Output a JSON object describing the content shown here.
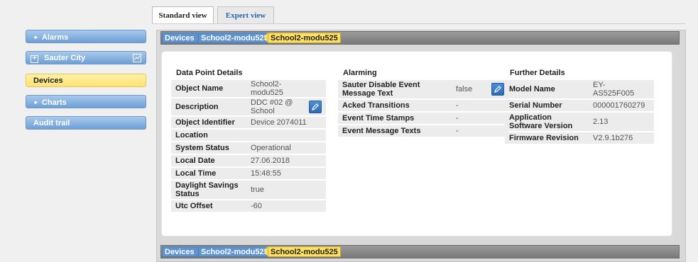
{
  "tabs": {
    "standard": "Standard view",
    "expert": "Expert view"
  },
  "sidebar": {
    "items": [
      {
        "label": "Alarms",
        "icon": "triangle-right-icon"
      },
      {
        "label": "Sauter City",
        "icon": "expand-plus-icon"
      },
      {
        "label": "Devices"
      },
      {
        "label": "Charts",
        "icon": "triangle-right-icon"
      },
      {
        "label": "Audit trail"
      }
    ]
  },
  "breadcrumb": [
    "Devices",
    "School2-modu525",
    "School2-modu525"
  ],
  "data_point_details": {
    "title": "Data Point Details",
    "rows": [
      {
        "key": "Object Name",
        "value": "School2-\nmodu525"
      },
      {
        "key": "Description",
        "value": "DDC #02 @\nSchool"
      },
      {
        "key": "Object Identifier",
        "value": "Device 2074011"
      },
      {
        "key": "Location",
        "value": ""
      },
      {
        "key": "System Status",
        "value": "Operational"
      },
      {
        "key": "Local Date",
        "value": "27.06.2018"
      },
      {
        "key": "Local Time",
        "value": "15:48:55"
      },
      {
        "key": "Daylight Savings Status",
        "value": "true"
      },
      {
        "key": "Utc Offset",
        "value": "-60"
      }
    ]
  },
  "alarming": {
    "title": "Alarming",
    "rows": [
      {
        "key": "Sauter Disable Event Message Text",
        "value": "false"
      },
      {
        "key": "Acked Transitions",
        "value": "-"
      },
      {
        "key": "Event Time Stamps",
        "value": "-"
      },
      {
        "key": "Event Message Texts",
        "value": "-"
      }
    ]
  },
  "further_details": {
    "title": "Further Details",
    "rows": [
      {
        "key": "Model Name",
        "value": "EY-\nAS525F005"
      },
      {
        "key": "Serial Number",
        "value": "000001760279"
      },
      {
        "key": "Application Software Version",
        "value": "2.13"
      },
      {
        "key": "Firmware Revision",
        "value": "V2.9.1b276"
      }
    ]
  },
  "colors": {
    "accent_blue": "#6d9fd7",
    "active_yellow": "#ffe373",
    "link_blue": "#2466b0"
  }
}
